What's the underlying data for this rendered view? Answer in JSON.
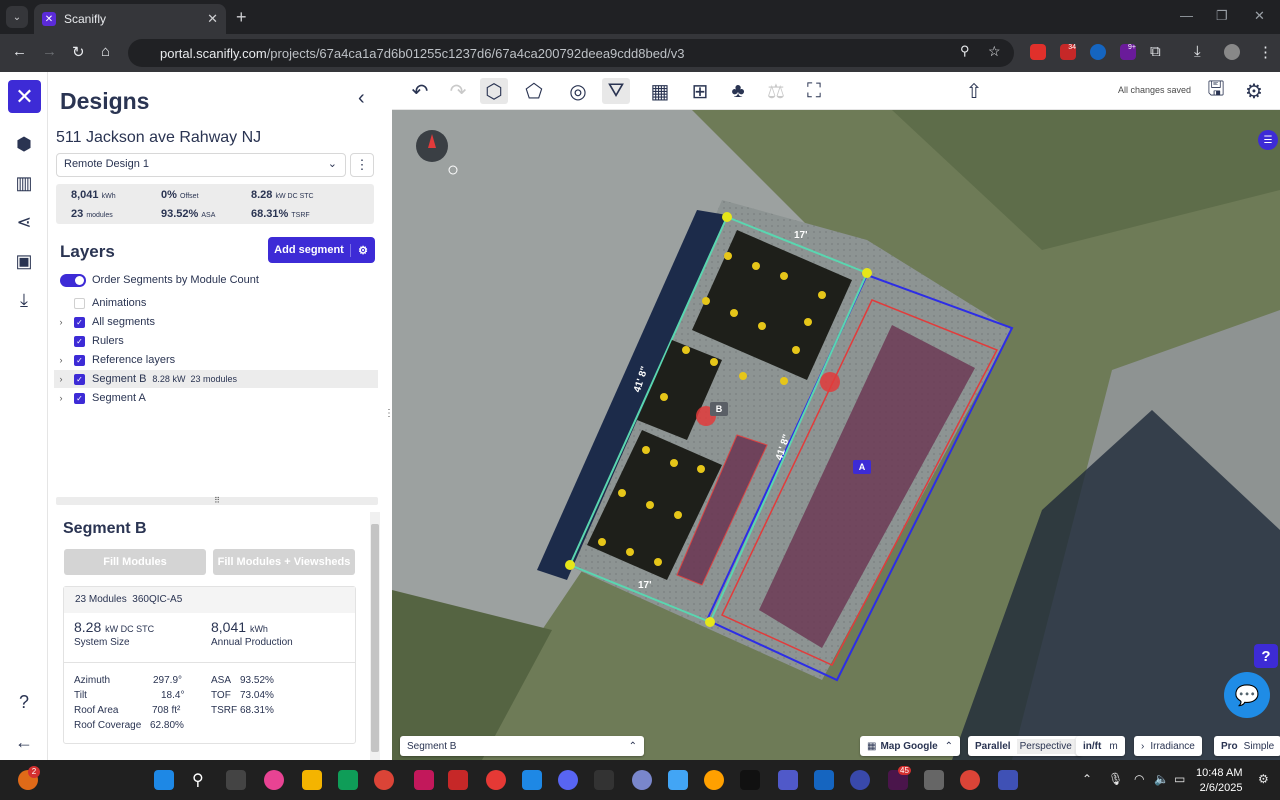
{
  "browser": {
    "tab_title": "Scanifly",
    "url_host": "portal.scanifly.com",
    "url_path": "/projects/67a4ca1a7d6b01255c1237d6/67a4ca200792deea9cdd8bed/v3",
    "ext_badge_1": "34",
    "ext_badge_2": "9+"
  },
  "panel": {
    "title": "Designs",
    "address": "511 Jackson ave Rahway NJ",
    "design_select": "Remote Design 1",
    "stats": {
      "production": "8,041",
      "production_unit": "kWh",
      "offset": "0%",
      "offset_unit": "Offset",
      "system_size": "8.28",
      "system_size_unit": "kW DC STC",
      "modules": "23",
      "modules_unit": "modules",
      "asa": "93.52%",
      "asa_unit": "ASA",
      "tsrf": "68.31%",
      "tsrf_unit": "TSRF"
    },
    "layers_title": "Layers",
    "add_segment": "Add segment",
    "layers": [
      {
        "label": "Order Segments by Module Count"
      },
      {
        "label": "Animations"
      },
      {
        "label": "All segments"
      },
      {
        "label": "Rulers"
      },
      {
        "label": "Reference layers"
      },
      {
        "label": "Segment B",
        "meta_kw": "8.28",
        "meta_kw_unit": "kW",
        "meta_modules": "23",
        "meta_modules_unit": "modules"
      },
      {
        "label": "Segment A"
      }
    ],
    "segment": {
      "title": "Segment B",
      "fill_modules": "Fill Modules",
      "fill_viewsheds": "Fill Modules + Viewsheds",
      "card_head_count": "23 Modules",
      "card_head_model": "360QIC-A5",
      "system_size": "8.28",
      "system_size_unit": "kW DC STC",
      "system_size_label": "System Size",
      "annual": "8,041",
      "annual_unit": "kWh",
      "annual_label": "Annual Production",
      "left_kv": [
        {
          "k": "Azimuth",
          "v": "297.9°"
        },
        {
          "k": "Tilt",
          "v": "18.4°"
        },
        {
          "k": "Roof Area",
          "v": "708 ft²"
        },
        {
          "k": "Roof Coverage",
          "v": "62.80%"
        }
      ],
      "right_kv": [
        {
          "k": "ASA",
          "v": "93.52%"
        },
        {
          "k": "TOF",
          "v": "73.04%"
        },
        {
          "k": "TSRF",
          "v": "68.31%"
        }
      ]
    }
  },
  "toolbar": {
    "saved_status": "All changes saved"
  },
  "map": {
    "dimension_1": "41' 8\"",
    "dimension_2": "41' 8\"",
    "dimension_3": "17'",
    "dimension_4": "17'",
    "label_a": "A",
    "label_b": "B",
    "segment_select": "Segment B",
    "map_source": "Map Google",
    "view_parallel": "Parallel",
    "view_perspective": "Perspective",
    "unit_inft": "in/ft",
    "unit_m": "m",
    "irradiance": "Irradiance",
    "mode_pro": "Pro",
    "mode_simple": "Simple",
    "help": "?"
  },
  "taskbar": {
    "time": "10:48 AM",
    "date": "2/6/2025",
    "notif_badge": "2",
    "badge_45": "45"
  },
  "colors": {
    "brand": "#3d2bd6",
    "segment_b_outline": "#5ad6b0",
    "segment_a_outline": "#2d2de6",
    "setback": "#e23b3b"
  }
}
